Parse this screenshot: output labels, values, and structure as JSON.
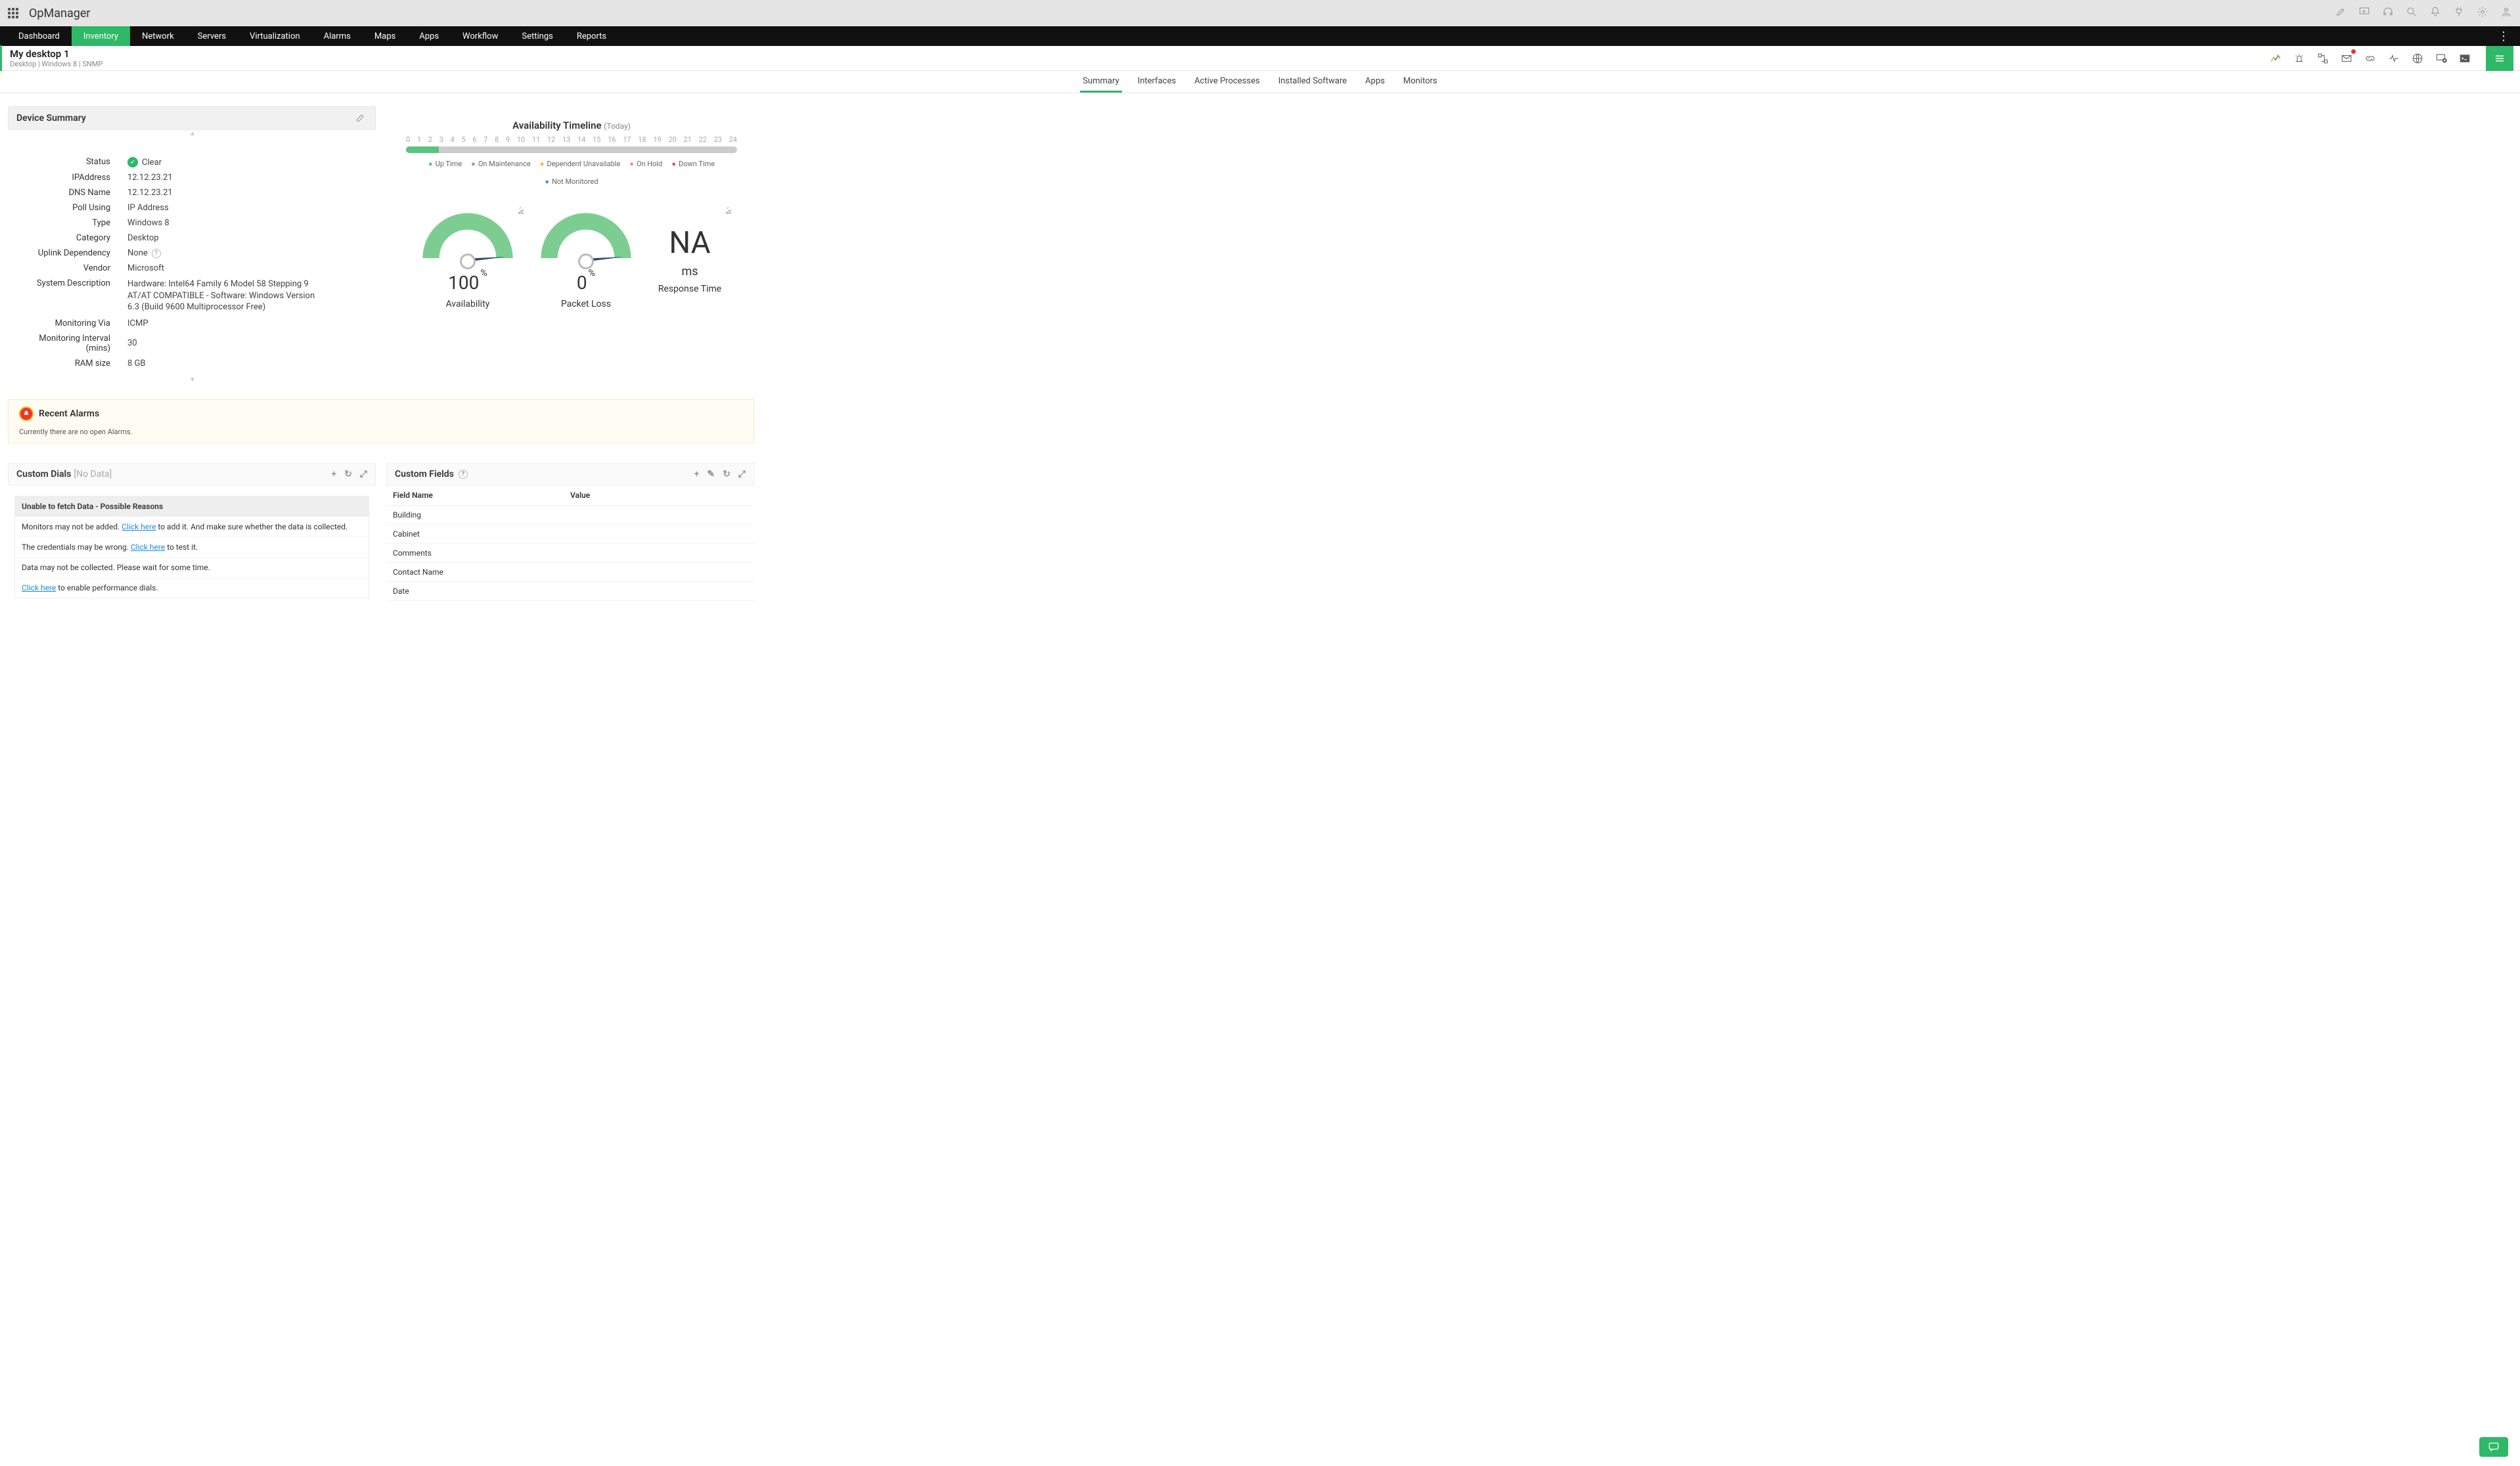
{
  "app": {
    "title": "OpManager"
  },
  "mainnav": {
    "items": [
      "Dashboard",
      "Inventory",
      "Network",
      "Servers",
      "Virtualization",
      "Alarms",
      "Maps",
      "Apps",
      "Workflow",
      "Settings",
      "Reports"
    ],
    "active": "Inventory"
  },
  "device": {
    "title": "My desktop 1",
    "sub": "Desktop | Windows 8  | SNMP"
  },
  "subtabs": {
    "items": [
      "Summary",
      "Interfaces",
      "Active Processes",
      "Installed Software",
      "Apps",
      "Monitors"
    ],
    "active": "Summary"
  },
  "summaryPanel": {
    "title": "Device Summary",
    "rows": {
      "status_l": "Status",
      "status_v": "Clear",
      "ip_l": "IPAddress",
      "ip_v": "12.12.23.21",
      "dns_l": "DNS Name",
      "dns_v": "12.12.23.21",
      "poll_l": "Poll Using",
      "poll_v": "IP Address",
      "type_l": "Type",
      "type_v": "Windows 8",
      "cat_l": "Category",
      "cat_v": "Desktop",
      "upl_l": "Uplink Dependency",
      "upl_v": "None",
      "vendor_l": "Vendor",
      "vendor_v": "Microsoft",
      "sysd_l": "System Description",
      "sysd_v": "Hardware: Intel64 Family 6 Model 58 Stepping 9 AT/AT COMPATIBLE - Software: Windows Version 6.3 (Build 9600 Multiprocessor Free)",
      "via_l": "Monitoring Via",
      "via_v": "ICMP",
      "int_l": "Monitoring Interval (mins)",
      "int_v": "30",
      "ram_l": "RAM size",
      "ram_v": "8 GB"
    }
  },
  "avail": {
    "title": "Availability Timeline",
    "today": "(Today)",
    "hours": [
      "0",
      "1",
      "2",
      "3",
      "4",
      "5",
      "6",
      "7",
      "8",
      "9",
      "10",
      "11",
      "12",
      "13",
      "14",
      "15",
      "16",
      "17",
      "18",
      "19",
      "20",
      "21",
      "22",
      "23",
      "24"
    ],
    "legend": {
      "up": "Up Time",
      "maint": "On Maintenance",
      "dep": "Dependent Unavailable",
      "hold": "On Hold",
      "down": "Down Time",
      "nm": "Not Monitored"
    }
  },
  "gauges": {
    "avail": {
      "value": "100",
      "unit": "%",
      "label": "Availability"
    },
    "loss": {
      "value": "0",
      "unit": "%",
      "label": "Packet Loss"
    },
    "resp": {
      "value": "NA",
      "unit": "ms",
      "label": "Response Time"
    }
  },
  "alarms": {
    "title": "Recent Alarms",
    "empty": "Currently there are no open Alarms."
  },
  "dials": {
    "title": "Custom Dials",
    "nodata": "[No Data]",
    "reasons_title": "Unable to fetch Data - Possible Reasons",
    "r1a": "Monitors may not be added.  ",
    "r1link": "Click here",
    "r1b": " to add it. And make sure whether the data is collected.",
    "r2a": "The credentials may be wrong.  ",
    "r2link": "Click here",
    "r2b": " to test it.",
    "r3": "Data may not be collected. Please wait for some time.",
    "r4link": "Click here",
    "r4b": " to enable performance dials."
  },
  "cfields": {
    "title": "Custom Fields",
    "col1": "Field Name",
    "col2": "Value",
    "rows": [
      "Building",
      "Cabinet",
      "Comments",
      "Contact Name",
      "Date"
    ]
  }
}
